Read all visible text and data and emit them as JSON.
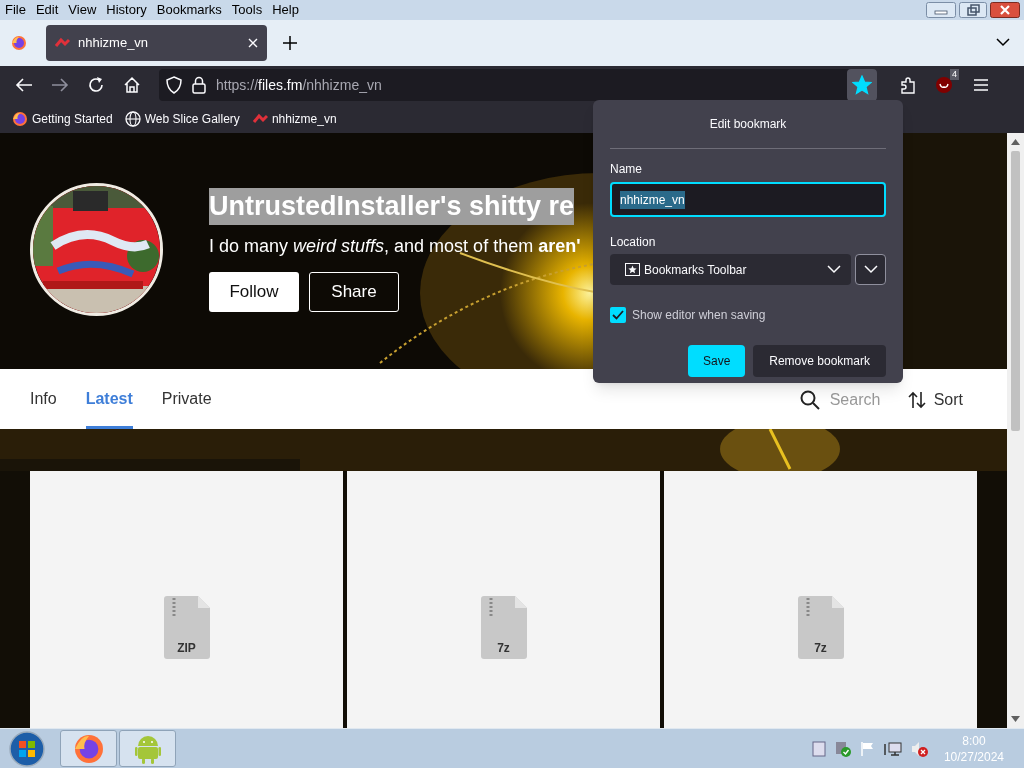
{
  "menu_bar": [
    "File",
    "Edit",
    "View",
    "History",
    "Bookmarks",
    "Tools",
    "Help"
  ],
  "tabs": [
    {
      "title": "nhhizme_vn",
      "selected": true
    }
  ],
  "address": {
    "scheme": "https://",
    "host": "files.fm",
    "path": "/nhhizme_vn"
  },
  "toolbar": {
    "bookmarked": true,
    "extension_badge": "4"
  },
  "bookmarks": [
    {
      "label": "Getting Started",
      "kind": "firefox"
    },
    {
      "label": "Web Slice Gallery",
      "kind": "globe"
    },
    {
      "label": "nhhizme_vn",
      "kind": "site"
    }
  ],
  "profile": {
    "title": "UntrustedInstaller's shitty re",
    "bio": "I do many *weird stuffs*, and most of them **aren'**",
    "buttons": [
      "Follow",
      "Share"
    ]
  },
  "page_tabs": [
    {
      "label": "Info",
      "selected": false
    },
    {
      "label": "Latest",
      "selected": true
    },
    {
      "label": "Private",
      "selected": false
    }
  ],
  "search": {
    "placeholder": "Search"
  },
  "sort": "Sort",
  "files": [
    {
      "type": "ZIP"
    },
    {
      "type": "7z"
    },
    {
      "type": "7z"
    }
  ],
  "popup": {
    "title": "Edit bookmark",
    "name_label": "Name",
    "name_value": "nhhizme_vn",
    "location_label": "Location",
    "location_value": "Bookmarks Toolbar",
    "show_editor": {
      "label": "Show editor when saving",
      "checked": true
    },
    "buttons": [
      "Save",
      "Remove bookmark"
    ]
  },
  "taskbar": {
    "apps": [
      {
        "kind": "firefox"
      },
      {
        "kind": "android"
      }
    ],
    "time": "8:00",
    "date": "10/27/2024"
  }
}
